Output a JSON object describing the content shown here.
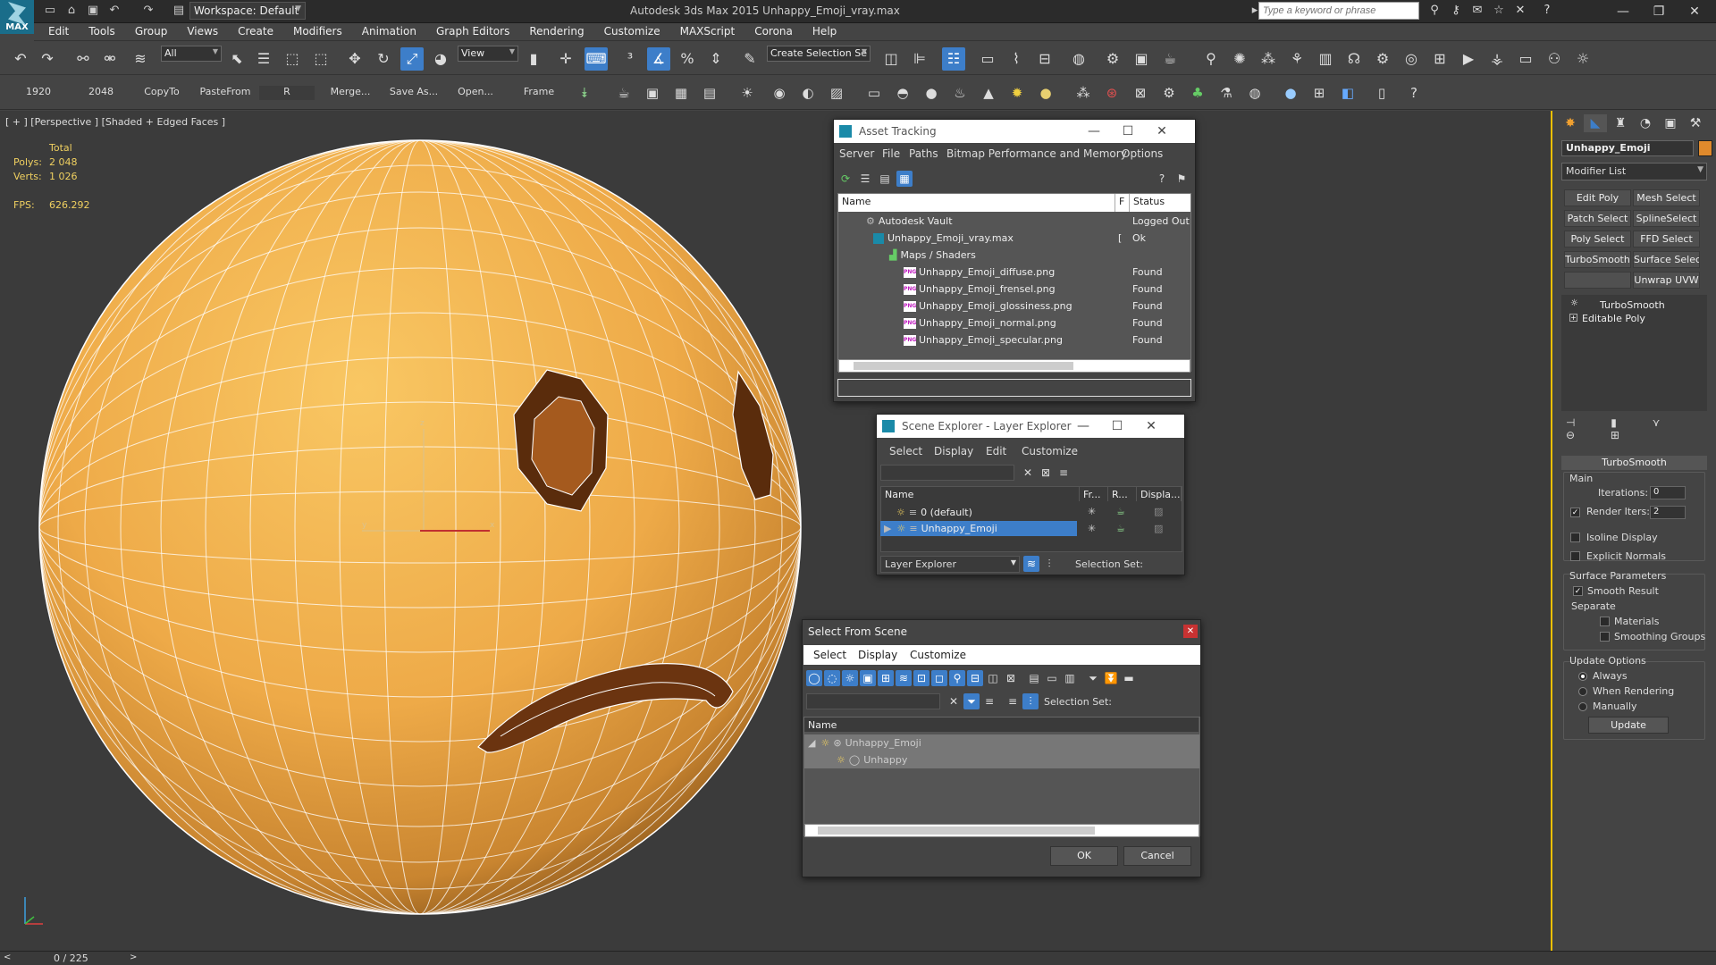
{
  "app": {
    "title": "Autodesk 3ds Max  2015     Unhappy_Emoji_vray.max",
    "logo_text": "MAX",
    "workspace": "Workspace: Default",
    "search_placeholder": "Type a keyword or phrase"
  },
  "menu": [
    "Edit",
    "Tools",
    "Group",
    "Views",
    "Create",
    "Modifiers",
    "Animation",
    "Graph Editors",
    "Rendering",
    "Customize",
    "MAXScript",
    "Corona",
    "Help"
  ],
  "toolbar1": {
    "selection_filter": "All",
    "ref_coord": "View",
    "selection_set_placeholder": "Create Selection Se"
  },
  "toolbar2": {
    "buttons": [
      "1920",
      "2048",
      "CopyTo",
      "PasteFrom",
      "R",
      "Merge...",
      "Save As...",
      "Open...",
      "Frame"
    ]
  },
  "viewport": {
    "label": "[ + ] [Perspective ] [Shaded + Edged Faces ]",
    "stats": {
      "total_label": "Total",
      "polys_label": "Polys:",
      "polys": "2 048",
      "verts_label": "Verts:",
      "verts": "1 026",
      "fps_label": "FPS:",
      "fps": "626.292"
    },
    "gizmo": {
      "x": "x",
      "y": "y",
      "z": "z"
    }
  },
  "command_panel": {
    "object_name": "Unhappy_Emoji",
    "object_color": "#e08a2c",
    "modifier_list": "Modifier List",
    "mod_buttons": [
      "Edit Poly",
      "Mesh Select",
      "Patch Select",
      "SplineSelect",
      "Poly Select",
      "FFD Select",
      "TurboSmooth",
      "Surface Select",
      "",
      "Unwrap UVW"
    ],
    "stack": [
      "TurboSmooth",
      "Editable Poly"
    ],
    "turbosmooth": {
      "header": "TurboSmooth",
      "main_label": "Main",
      "iterations_label": "Iterations:",
      "iterations": "0",
      "render_iters_label": "Render Iters:",
      "render_iters": "2",
      "isoline": "Isoline Display",
      "explicit_normals": "Explicit Normals",
      "surface_params": "Surface Parameters",
      "smooth_result": "Smooth Result",
      "separate": "Separate",
      "materials": "Materials",
      "smoothing_groups": "Smoothing Groups",
      "update_options": "Update Options",
      "always": "Always",
      "when_rendering": "When Rendering",
      "manually": "Manually",
      "update_btn": "Update"
    }
  },
  "asset_tracking": {
    "title": "Asset Tracking",
    "menu": [
      "Server",
      "File",
      "Paths",
      "Bitmap Performance and Memory",
      "Options"
    ],
    "columns": [
      "Name",
      "F",
      "Status"
    ],
    "rows": [
      {
        "name": "Autodesk Vault",
        "f": "",
        "status": "Logged Out"
      },
      {
        "name": "Unhappy_Emoji_vray.max",
        "f": "[",
        "status": "Ok"
      },
      {
        "name": "Maps / Shaders",
        "f": "",
        "status": ""
      },
      {
        "name": "Unhappy_Emoji_diffuse.png",
        "f": "",
        "status": "Found"
      },
      {
        "name": "Unhappy_Emoji_frensel.png",
        "f": "",
        "status": "Found"
      },
      {
        "name": "Unhappy_Emoji_glossiness.png",
        "f": "",
        "status": "Found"
      },
      {
        "name": "Unhappy_Emoji_normal.png",
        "f": "",
        "status": "Found"
      },
      {
        "name": "Unhappy_Emoji_specular.png",
        "f": "",
        "status": "Found"
      }
    ],
    "png_tag": "PNG"
  },
  "scene_explorer": {
    "title": "Scene Explorer - Layer Explorer",
    "menu": [
      "Select",
      "Display",
      "Edit",
      "Customize"
    ],
    "columns": [
      "Name",
      "Fr...",
      "R...",
      "Displa..."
    ],
    "rows": [
      "0 (default)",
      "Unhappy_Emoji"
    ],
    "footer_mode": "Layer Explorer",
    "selection_set": "Selection Set:"
  },
  "select_from_scene": {
    "title": "Select From Scene",
    "menu": [
      "Select",
      "Display",
      "Customize"
    ],
    "selection_set": "Selection Set:",
    "column": "Name",
    "rows": [
      "Unhappy_Emoji",
      "Unhappy"
    ],
    "ok": "OK",
    "cancel": "Cancel"
  },
  "status": {
    "time": "0 / 225"
  }
}
